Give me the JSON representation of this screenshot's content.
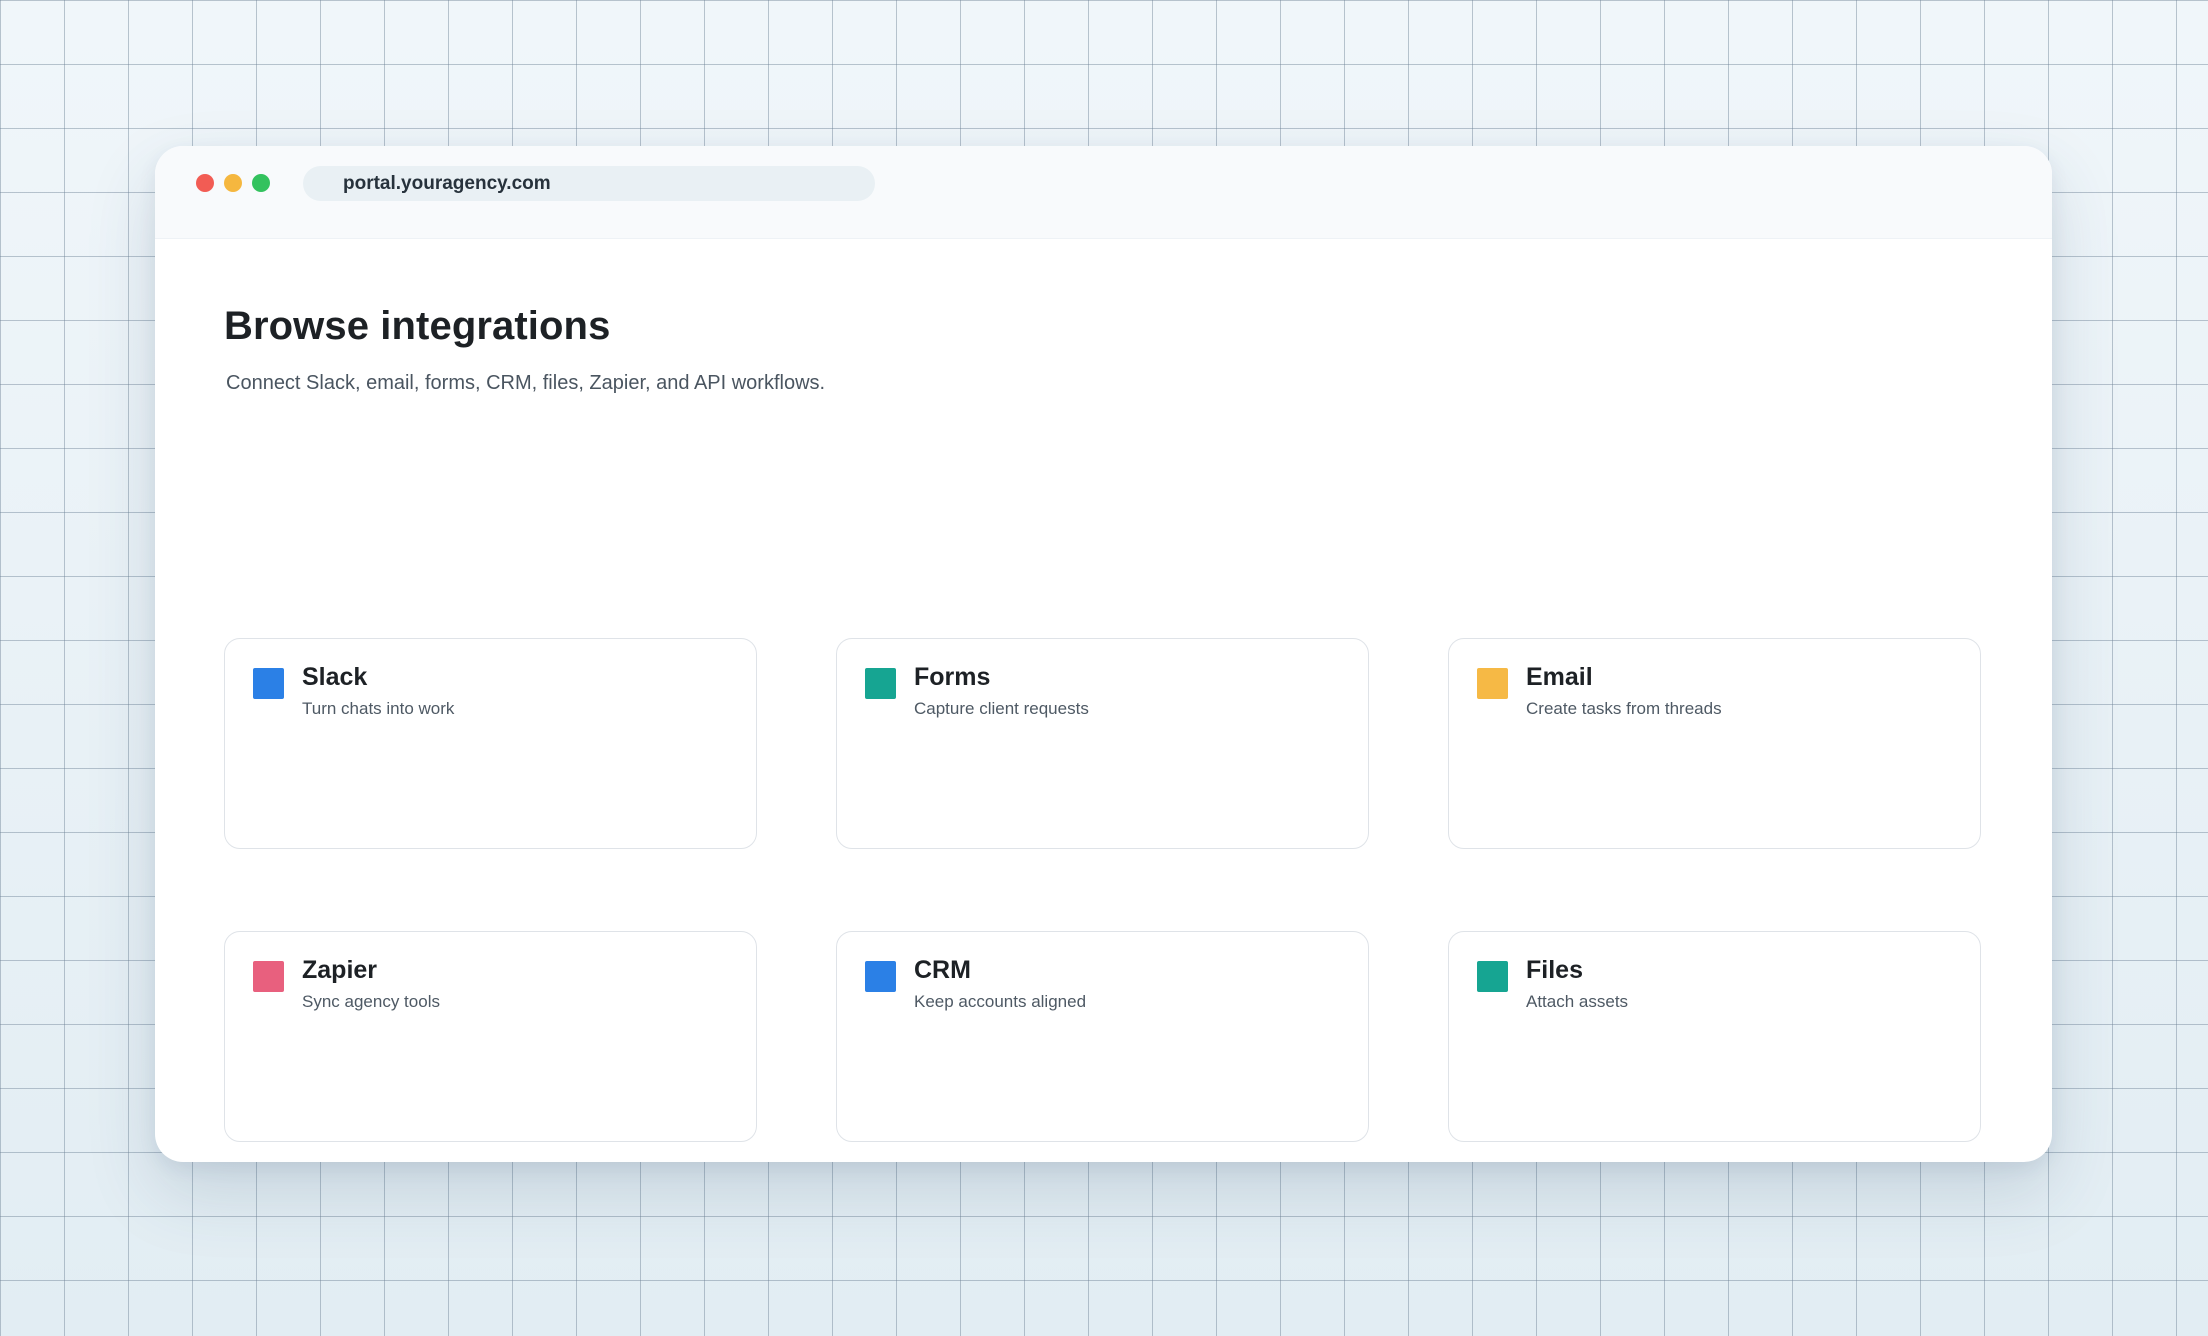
{
  "browser": {
    "url": "portal.youragency.com",
    "window_controls": [
      {
        "name": "close",
        "color": "#f25c54"
      },
      {
        "name": "minimize",
        "color": "#f5b73f"
      },
      {
        "name": "maximize",
        "color": "#33c25e"
      }
    ]
  },
  "page": {
    "title": "Browse integrations",
    "subtitle": "Connect Slack, email, forms, CRM, files, Zapier, and API workflows."
  },
  "integrations": [
    {
      "name": "Slack",
      "description": "Turn chats into work",
      "color": "#2b80e6"
    },
    {
      "name": "Forms",
      "description": "Capture client requests",
      "color": "#16a592"
    },
    {
      "name": "Email",
      "description": "Create tasks from threads",
      "color": "#f6b945"
    },
    {
      "name": "Zapier",
      "description": "Sync agency tools",
      "color": "#e8607e"
    },
    {
      "name": "CRM",
      "description": "Keep accounts aligned",
      "color": "#2b80e6"
    },
    {
      "name": "Files",
      "description": "Attach assets",
      "color": "#16a592"
    }
  ]
}
